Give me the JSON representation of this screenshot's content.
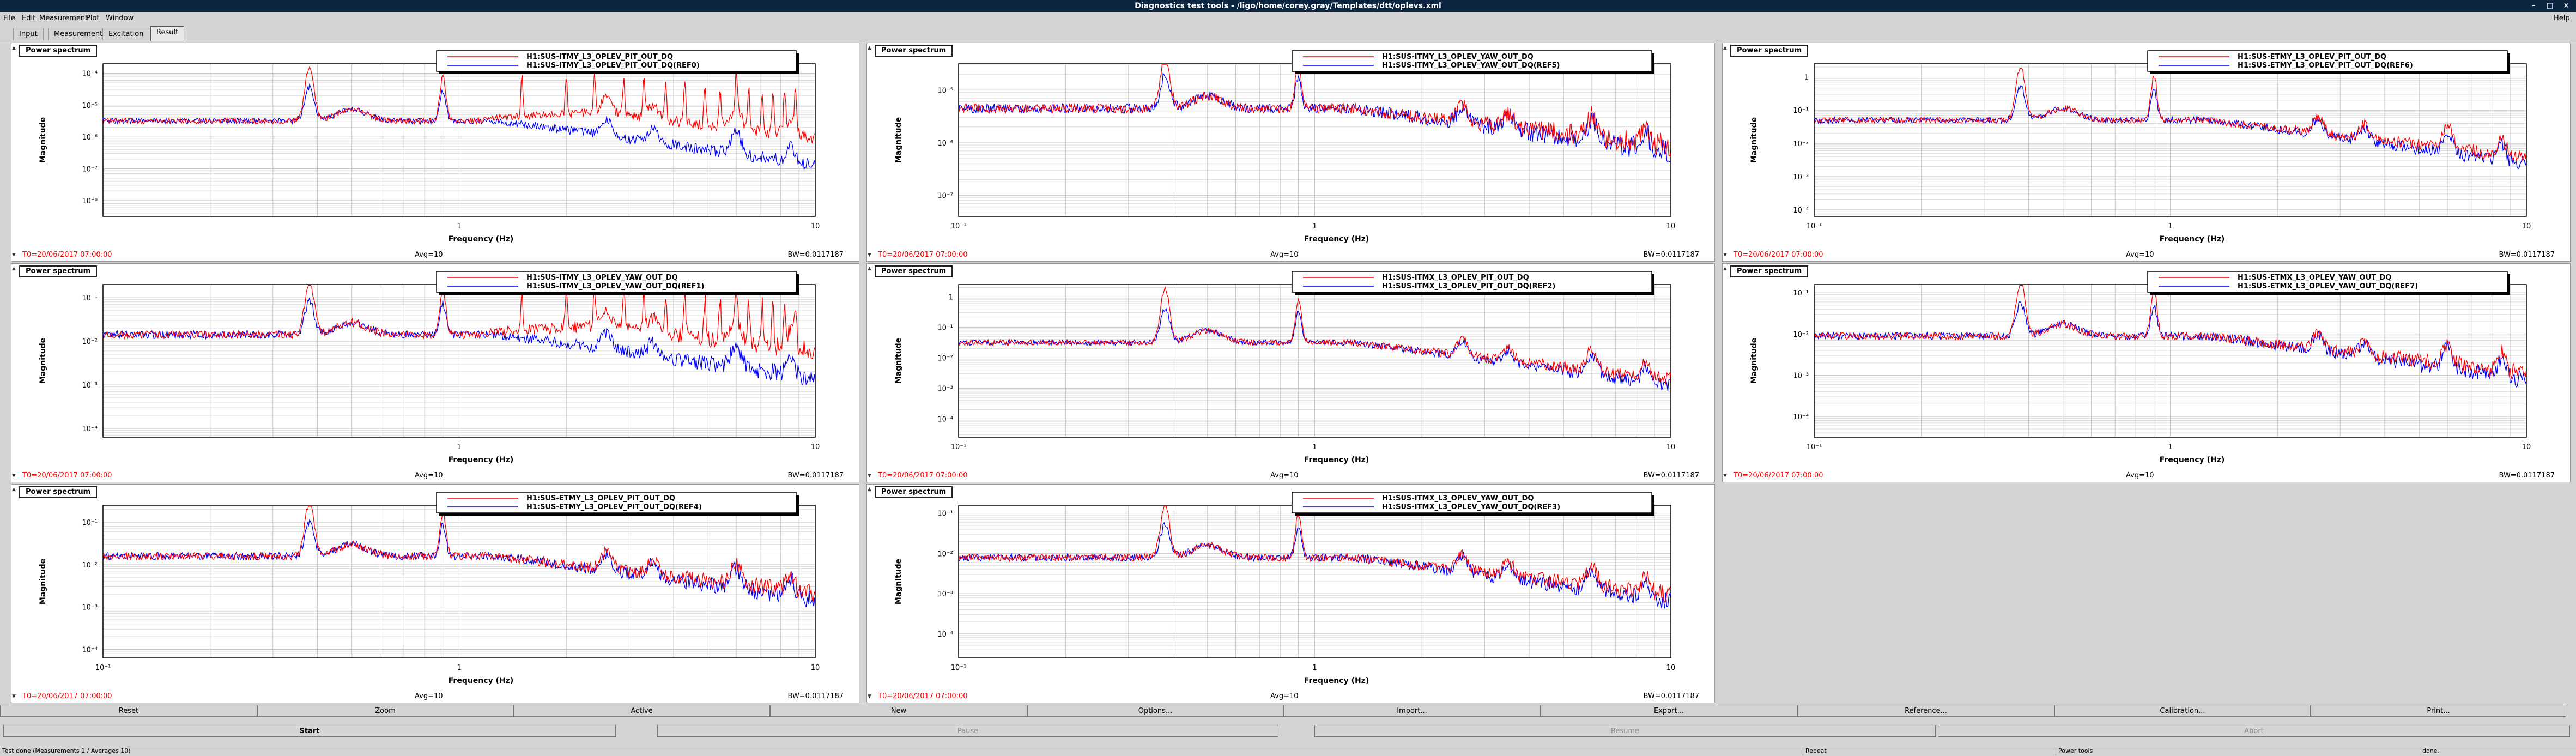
{
  "window": {
    "title": "Diagnostics test tools - /ligo/home/corey.gray/Templates/dtt/oplevs.xml",
    "controls": [
      "–",
      "□",
      "×"
    ]
  },
  "menu": [
    {
      "label": "File",
      "accel": "F"
    },
    {
      "label": "Edit",
      "accel": "E"
    },
    {
      "label": "Measurement",
      "accel": "M"
    },
    {
      "label": "Plot",
      "accel": "P"
    },
    {
      "label": "Window",
      "accel": "W"
    }
  ],
  "help_label": "Help",
  "tabs": [
    {
      "label": "Input",
      "active": false
    },
    {
      "label": "Measurement",
      "active": false
    },
    {
      "label": "Excitation",
      "active": false
    },
    {
      "label": "Result",
      "active": true
    }
  ],
  "colors": {
    "trace1": "#ff0000",
    "trace2": "#0000ff",
    "t0": "#ff0000",
    "titlebar": "#0b2440"
  },
  "panels": [
    {
      "header": "Power spectrum",
      "legend": [
        "H1:SUS-ITMY_L3_OPLEV_PIT_OUT_DQ",
        "H1:SUS-ITMY_L3_OPLEV_PIT_OUT_DQ(REF0)"
      ],
      "ylabel": "Magnitude",
      "xlabel": "Frequency (Hz)",
      "xticks": [
        {
          "v": 1,
          "label": "1"
        },
        {
          "v": 10,
          "label": "10"
        }
      ],
      "ylog": [
        -8.5,
        -3.7
      ],
      "yticks": [
        {
          "e": -4,
          "label": "10⁻⁴"
        },
        {
          "e": -5,
          "label": "10⁻⁵"
        },
        {
          "e": -6,
          "label": "10⁻⁶"
        },
        {
          "e": -7,
          "label": "10⁻⁷"
        },
        {
          "e": -8,
          "label": "10⁻⁸"
        }
      ],
      "xmin": 0.1,
      "t0": "T0=20/06/2017 07:00:00",
      "avg": "Avg=10",
      "bw": "BW=0.0117187"
    },
    {
      "header": "Power spectrum",
      "legend": [
        "H1:SUS-ITMY_L3_OPLEV_YAW_OUT_DQ",
        "H1:SUS-ITMY_L3_OPLEV_YAW_OUT_DQ(REF5)"
      ],
      "ylabel": "Magnitude",
      "xlabel": "Frequency (Hz)",
      "xticks": [
        {
          "v": 0.1,
          "label": "10⁻¹"
        },
        {
          "v": 1,
          "label": "1"
        },
        {
          "v": 10,
          "label": "10"
        }
      ],
      "ylog": [
        -7.4,
        -4.5
      ],
      "yticks": [
        {
          "e": -5,
          "label": "10⁻⁵"
        },
        {
          "e": -6,
          "label": "10⁻⁶"
        },
        {
          "e": -7,
          "label": "10⁻⁷"
        }
      ],
      "xmin": 0.1,
      "t0": "T0=20/06/2017 07:00:00",
      "avg": "Avg=10",
      "bw": "BW=0.0117187"
    },
    {
      "header": "Power spectrum",
      "legend": [
        "H1:SUS-ETMY_L3_OPLEV_PIT_OUT_DQ",
        "H1:SUS-ETMY_L3_OPLEV_PIT_OUT_DQ(REF6)"
      ],
      "ylabel": "Magnitude",
      "xlabel": "Frequency (Hz)",
      "xticks": [
        {
          "v": 0.1,
          "label": "10⁻¹"
        },
        {
          "v": 1,
          "label": "1"
        },
        {
          "v": 10,
          "label": "10"
        }
      ],
      "ylog": [
        -4.2,
        0.4
      ],
      "yticks": [
        {
          "e": 0,
          "label": "1"
        },
        {
          "e": -1,
          "label": "10⁻¹"
        },
        {
          "e": -2,
          "label": "10⁻²"
        },
        {
          "e": -3,
          "label": "10⁻³"
        },
        {
          "e": -4,
          "label": "10⁻⁴"
        }
      ],
      "xmin": 0.1,
      "t0": "T0=20/06/2017 07:00:00",
      "avg": "Avg=10",
      "bw": "BW=0.0117187"
    },
    {
      "header": "Power spectrum",
      "legend": [
        "H1:SUS-ITMY_L3_OPLEV_YAW_OUT_DQ",
        "H1:SUS-ITMY_L3_OPLEV_YAW_OUT_DQ(REF1)"
      ],
      "ylabel": "Magnitude",
      "xlabel": "Frequency (Hz)",
      "xticks": [
        {
          "v": 1,
          "label": "1"
        },
        {
          "v": 10,
          "label": "10"
        }
      ],
      "ylog": [
        -4.2,
        -0.7
      ],
      "yticks": [
        {
          "e": -1,
          "label": "10⁻¹"
        },
        {
          "e": -2,
          "label": "10⁻²"
        },
        {
          "e": -3,
          "label": "10⁻³"
        },
        {
          "e": -4,
          "label": "10⁻⁴"
        }
      ],
      "xmin": 0.1,
      "t0": "T0=20/06/2017 07:00:00",
      "avg": "Avg=10",
      "bw": "BW=0.0117187"
    },
    {
      "header": "Power spectrum",
      "legend": [
        "H1:SUS-ITMX_L3_OPLEV_PIT_OUT_DQ",
        "H1:SUS-ITMX_L3_OPLEV_PIT_OUT_DQ(REF2)"
      ],
      "ylabel": "Magnitude",
      "xlabel": "Frequency (Hz)",
      "xticks": [
        {
          "v": 0.1,
          "label": "10⁻¹"
        },
        {
          "v": 1,
          "label": "1"
        },
        {
          "v": 10,
          "label": "10"
        }
      ],
      "ylog": [
        -4.6,
        0.4
      ],
      "yticks": [
        {
          "e": 0,
          "label": "1"
        },
        {
          "e": -1,
          "label": "10⁻¹"
        },
        {
          "e": -2,
          "label": "10⁻²"
        },
        {
          "e": -3,
          "label": "10⁻³"
        },
        {
          "e": -4,
          "label": "10⁻⁴"
        }
      ],
      "xmin": 0.1,
      "t0": "T0=20/06/2017 07:00:00",
      "avg": "Avg=10",
      "bw": "BW=0.0117187"
    },
    {
      "header": "Power spectrum",
      "legend": [
        "H1:SUS-ETMX_L3_OPLEV_YAW_OUT_DQ",
        "H1:SUS-ETMX_L3_OPLEV_YAW_OUT_DQ(REF7)"
      ],
      "ylabel": "Magnitude",
      "xlabel": "Frequency (Hz)",
      "xticks": [
        {
          "v": 0.1,
          "label": "10⁻¹"
        },
        {
          "v": 1,
          "label": "1"
        },
        {
          "v": 10,
          "label": "10"
        }
      ],
      "ylog": [
        -4.5,
        -0.8
      ],
      "yticks": [
        {
          "e": -1,
          "label": "10⁻¹"
        },
        {
          "e": -2,
          "label": "10⁻²"
        },
        {
          "e": -3,
          "label": "10⁻³"
        },
        {
          "e": -4,
          "label": "10⁻⁴"
        }
      ],
      "xmin": 0.1,
      "t0": "T0=20/06/2017 07:00:00",
      "avg": "Avg=10",
      "bw": "BW=0.0117187"
    },
    {
      "header": "Power spectrum",
      "legend": [
        "H1:SUS-ETMY_L3_OPLEV_PIT_OUT_DQ",
        "H1:SUS-ETMY_L3_OPLEV_PIT_OUT_DQ(REF4)"
      ],
      "ylabel": "Magnitude",
      "xlabel": "Frequency (Hz)",
      "xticks": [
        {
          "v": 0.1,
          "label": "10⁻¹"
        },
        {
          "v": 1,
          "label": "1"
        },
        {
          "v": 10,
          "label": "10"
        }
      ],
      "ylog": [
        -4.2,
        -0.6
      ],
      "yticks": [
        {
          "e": -1,
          "label": "10⁻¹"
        },
        {
          "e": -2,
          "label": "10⁻²"
        },
        {
          "e": -3,
          "label": "10⁻³"
        },
        {
          "e": -4,
          "label": "10⁻⁴"
        }
      ],
      "xmin": 0.1,
      "t0": "T0=20/06/2017 07:00:00",
      "avg": "Avg=10",
      "bw": "BW=0.0117187"
    },
    {
      "header": "Power spectrum",
      "legend": [
        "H1:SUS-ITMX_L3_OPLEV_YAW_OUT_DQ",
        "H1:SUS-ITMX_L3_OPLEV_YAW_OUT_DQ(REF3)"
      ],
      "ylabel": "Magnitude",
      "xlabel": "Frequency (Hz)",
      "xticks": [
        {
          "v": 0.1,
          "label": "10⁻¹"
        },
        {
          "v": 1,
          "label": "1"
        },
        {
          "v": 10,
          "label": "10"
        }
      ],
      "ylog": [
        -4.6,
        -0.8
      ],
      "yticks": [
        {
          "e": -1,
          "label": "10⁻¹"
        },
        {
          "e": -2,
          "label": "10⁻²"
        },
        {
          "e": -3,
          "label": "10⁻³"
        },
        {
          "e": -4,
          "label": "10⁻⁴"
        }
      ],
      "xmin": 0.1,
      "t0": "T0=20/06/2017 07:00:00",
      "avg": "Avg=10",
      "bw": "BW=0.0117187"
    }
  ],
  "chart_data": [
    {
      "type": "line",
      "title": "Power spectrum",
      "xlabel": "Frequency (Hz)",
      "ylabel": "Magnitude",
      "xscale": "log",
      "yscale": "log",
      "xlim": [
        0.1,
        10
      ],
      "ylim": [
        3e-09,
        0.0002
      ],
      "grid": true,
      "legend_position": "top-right",
      "series": [
        {
          "name": "H1:SUS-ITMY_L3_OPLEV_PIT_OUT_DQ",
          "x": [
            0.1,
            0.2,
            0.38,
            0.5,
            0.9,
            2,
            5,
            10
          ],
          "y": [
            2e-05,
            8e-06,
            0.0001,
            5e-06,
            3e-05,
            3e-06,
            1e-06,
            2e-07
          ]
        },
        {
          "name": "H1:SUS-ITMY_L3_OPLEV_PIT_OUT_DQ(REF0)",
          "x": [
            0.1,
            0.2,
            0.38,
            0.5,
            0.9,
            2,
            5,
            10
          ],
          "y": [
            2e-05,
            8e-06,
            5e-05,
            3e-06,
            1e-05,
            1e-06,
            1e-07,
            2e-08
          ]
        }
      ]
    },
    {
      "type": "line",
      "title": "Power spectrum",
      "xlabel": "Frequency (Hz)",
      "ylabel": "Magnitude",
      "xscale": "log",
      "yscale": "log",
      "xlim": [
        0.1,
        10
      ],
      "ylim": [
        4e-08,
        3e-05
      ],
      "grid": true,
      "legend_position": "top-right",
      "series": [
        {
          "name": "H1:SUS-ITMY_L3_OPLEV_YAW_OUT_DQ",
          "x": [
            0.1,
            0.3,
            0.5,
            0.9,
            2,
            5,
            10
          ],
          "y": [
            1e-05,
            8e-06,
            2e-05,
            1e-06,
            1e-06,
            2e-07,
            1e-07
          ]
        },
        {
          "name": "H1:SUS-ITMY_L3_OPLEV_YAW_OUT_DQ(REF5)",
          "x": [
            0.1,
            0.3,
            0.5,
            0.9,
            2,
            5,
            10
          ],
          "y": [
            1e-05,
            3e-06,
            1e-05,
            8e-07,
            1e-06,
            1e-07,
            1e-07
          ]
        }
      ]
    },
    {
      "type": "line",
      "title": "Power spectrum",
      "xlabel": "Frequency (Hz)",
      "ylabel": "Magnitude",
      "xscale": "log",
      "yscale": "log",
      "xlim": [
        0.1,
        10
      ],
      "ylim": [
        6e-05,
        2.5
      ],
      "grid": true,
      "legend_position": "top-right",
      "series": [
        {
          "name": "H1:SUS-ETMY_L3_OPLEV_PIT_OUT_DQ",
          "x": [
            0.1,
            0.3,
            0.5,
            0.9,
            2,
            5,
            10
          ],
          "y": [
            0.1,
            0.1,
            2,
            0.02,
            0.004,
            0.0003,
            0.0003
          ]
        },
        {
          "name": "H1:SUS-ETMY_L3_OPLEV_PIT_OUT_DQ(REF6)",
          "x": [
            0.1,
            0.3,
            0.5,
            0.9,
            2,
            5,
            10
          ],
          "y": [
            0.1,
            0.05,
            0.1,
            0.01,
            0.003,
            0.0003,
            0.0003
          ]
        }
      ]
    },
    {
      "type": "line",
      "title": "Power spectrum",
      "xlabel": "Frequency (Hz)",
      "ylabel": "Magnitude",
      "xscale": "log",
      "yscale": "log",
      "xlim": [
        0.1,
        10
      ],
      "ylim": [
        6e-05,
        0.2
      ],
      "grid": true,
      "legend_position": "top-right",
      "series": [
        {
          "name": "H1:SUS-ITMY_L3_OPLEV_YAW_OUT_DQ",
          "x": [
            0.1,
            0.38,
            0.9,
            2,
            5,
            10
          ],
          "y": [
            0.01,
            0.1,
            0.03,
            0.01,
            0.005,
            0.0002
          ]
        },
        {
          "name": "H1:SUS-ITMY_L3_OPLEV_YAW_OUT_DQ(REF1)",
          "x": [
            0.1,
            0.38,
            0.9,
            2,
            5,
            10
          ],
          "y": [
            0.01,
            0.05,
            0.01,
            0.001,
            0.0002,
            0.0001
          ]
        }
      ]
    },
    {
      "type": "line",
      "title": "Power spectrum",
      "xlabel": "Frequency (Hz)",
      "ylabel": "Magnitude",
      "xscale": "log",
      "yscale": "log",
      "xlim": [
        0.1,
        10
      ],
      "ylim": [
        2.5e-05,
        2.5
      ],
      "grid": true,
      "legend_position": "top-right",
      "series": [
        {
          "name": "H1:SUS-ITMX_L3_OPLEV_PIT_OUT_DQ",
          "x": [
            0.1,
            0.3,
            0.5,
            0.9,
            2,
            5,
            10
          ],
          "y": [
            0.05,
            0.03,
            2,
            0.01,
            0.002,
            5e-05,
            0.0001
          ]
        },
        {
          "name": "H1:SUS-ITMX_L3_OPLEV_PIT_OUT_DQ(REF2)",
          "x": [
            0.1,
            0.3,
            0.5,
            0.9,
            2,
            5,
            10
          ],
          "y": [
            0.05,
            0.03,
            0.1,
            0.01,
            0.002,
            5e-05,
            0.0001
          ]
        }
      ]
    },
    {
      "type": "line",
      "title": "Power spectrum",
      "xlabel": "Frequency (Hz)",
      "ylabel": "Magnitude",
      "xscale": "log",
      "yscale": "log",
      "xlim": [
        0.1,
        10
      ],
      "ylim": [
        3e-05,
        0.16
      ],
      "grid": true,
      "legend_position": "top-right",
      "series": [
        {
          "name": "H1:SUS-ETMX_L3_OPLEV_YAW_OUT_DQ",
          "x": [
            0.1,
            0.3,
            0.5,
            0.9,
            2,
            5,
            10
          ],
          "y": [
            0.01,
            0.005,
            0.1,
            0.005,
            0.001,
            0.0002,
            0.0001
          ]
        },
        {
          "name": "H1:SUS-ETMX_L3_OPLEV_YAW_OUT_DQ(REF7)",
          "x": [
            0.1,
            0.3,
            0.5,
            0.9,
            2,
            5,
            10
          ],
          "y": [
            0.01,
            0.004,
            0.01,
            0.002,
            0.001,
            0.0002,
            0.0001
          ]
        }
      ]
    },
    {
      "type": "line",
      "title": "Power spectrum",
      "xlabel": "Frequency (Hz)",
      "ylabel": "Magnitude",
      "xscale": "log",
      "yscale": "log",
      "xlim": [
        0.1,
        10
      ],
      "ylim": [
        6e-05,
        0.25
      ],
      "grid": true,
      "legend_position": "top-right",
      "series": [
        {
          "name": "H1:SUS-ETMY_L3_OPLEV_PIT_OUT_DQ",
          "x": [
            0.1,
            0.3,
            0.5,
            0.9,
            2,
            5,
            10
          ],
          "y": [
            0.05,
            0.03,
            0.2,
            0.01,
            0.003,
            0.0002,
            0.0002
          ]
        },
        {
          "name": "H1:SUS-ETMY_L3_OPLEV_PIT_OUT_DQ(REF4)",
          "x": [
            0.1,
            0.3,
            0.5,
            0.9,
            2,
            5,
            10
          ],
          "y": [
            0.05,
            0.03,
            0.02,
            0.005,
            0.002,
            0.0002,
            0.0002
          ]
        }
      ]
    },
    {
      "type": "line",
      "title": "Power spectrum",
      "xlabel": "Frequency (Hz)",
      "ylabel": "Magnitude",
      "xscale": "log",
      "yscale": "log",
      "xlim": [
        0.1,
        10
      ],
      "ylim": [
        2.5e-05,
        0.16
      ],
      "grid": true,
      "legend_position": "top-right",
      "series": [
        {
          "name": "H1:SUS-ITMX_L3_OPLEV_YAW_OUT_DQ",
          "x": [
            0.1,
            0.3,
            0.5,
            0.9,
            2,
            5,
            10
          ],
          "y": [
            0.05,
            0.02,
            0.1,
            0.01,
            0.001,
            0.0001,
            0.0001
          ]
        },
        {
          "name": "H1:SUS-ITMX_L3_OPLEV_YAW_OUT_DQ(REF3)",
          "x": [
            0.1,
            0.3,
            0.5,
            0.9,
            2,
            5,
            10
          ],
          "y": [
            0.05,
            0.01,
            0.02,
            0.005,
            0.001,
            0.0001,
            0.0001
          ]
        }
      ]
    }
  ],
  "buttons_row1": [
    "Reset",
    "Zoom",
    "Active",
    "New",
    "Options...",
    "Import...",
    "Export...",
    "Reference...",
    "Calibration...",
    "Print..."
  ],
  "buttons_row2": [
    {
      "label": "Start",
      "enabled": true
    },
    {
      "label": "Pause",
      "enabled": false
    },
    {
      "label": "Resume",
      "enabled": false
    },
    {
      "label": "Abort",
      "enabled": false
    }
  ],
  "status": [
    "Test done (Measurements 1 / Averages 10)",
    "Repeat",
    "Power tools",
    "done."
  ]
}
